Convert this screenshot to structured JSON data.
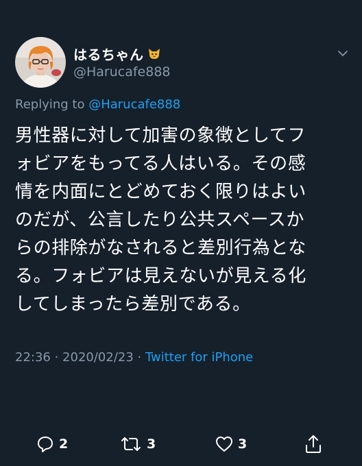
{
  "user": {
    "display_name": "はるちゃん",
    "handle": "@Harucafe888",
    "emoji": "cat-face-icon",
    "avatar": "profile-photo"
  },
  "reply": {
    "prefix": "Replying to",
    "mention": "@Harucafe888"
  },
  "body": {
    "lines": [
      "男性器に対して加害の象徴としてフ",
      "ォビアをもってる人はいる。その感",
      "情を内面にとどめておく限りはよい",
      "のだが、公言したり公共スペースか",
      "らの排除がなされると差別行為とな",
      "る。フォビアは見えないが見える化",
      "してしまったら差別である。"
    ]
  },
  "meta": {
    "time": "22:36",
    "separator1": " · ",
    "date": "2020/02/23",
    "separator2": " · ",
    "source": "Twitter for iPhone"
  },
  "actions": {
    "reply_count": "2",
    "retweet_count": "3",
    "like_count": "3"
  },
  "colors": {
    "background": "#15202b",
    "text": "#ffffff",
    "secondary": "#8899a6",
    "link": "#1da1f2"
  }
}
